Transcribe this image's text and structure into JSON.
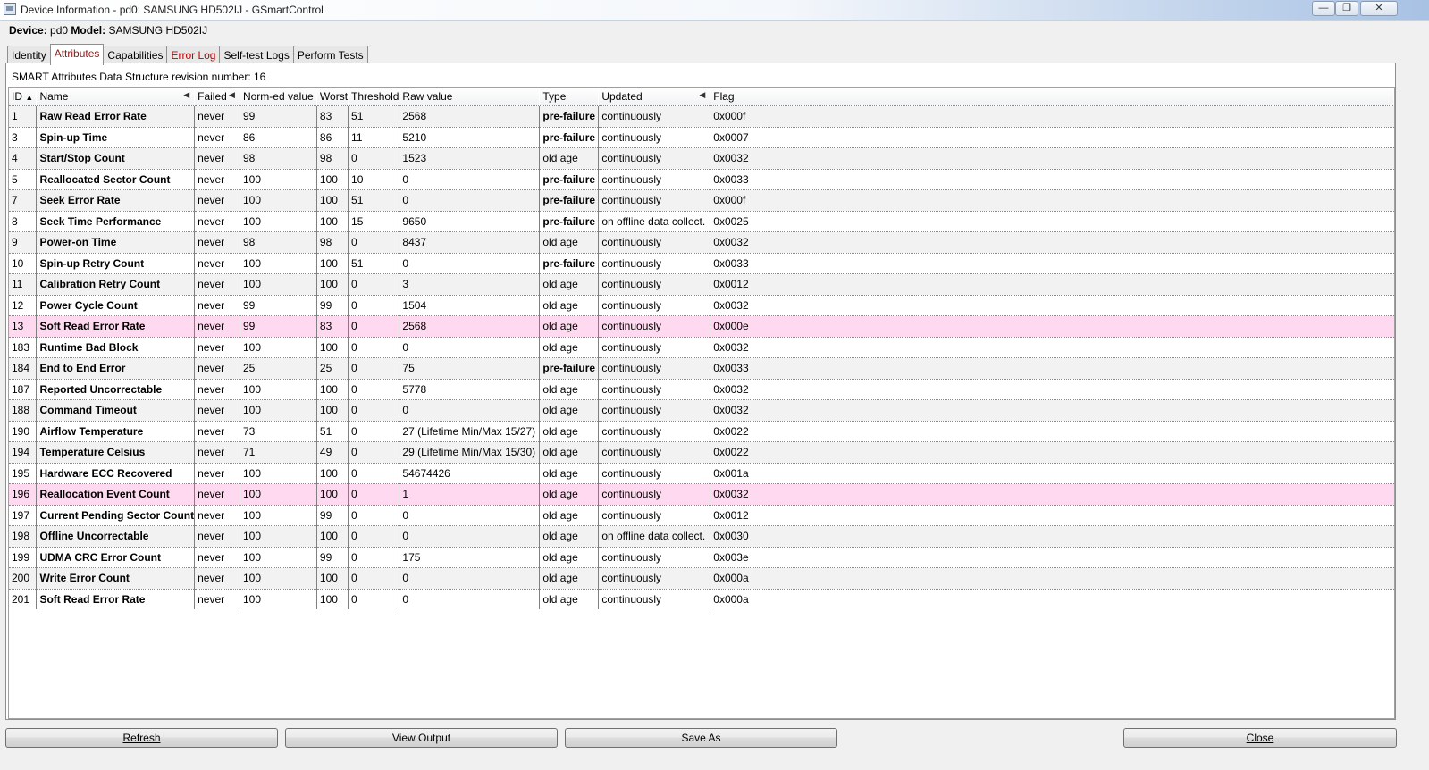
{
  "window": {
    "title": "Device Information - pd0: SAMSUNG HD502IJ - GSmartControl",
    "minimize_glyph": "—",
    "maximize_glyph": "❐",
    "close_glyph": "✕"
  },
  "device": {
    "device_label": "Device:",
    "device_value": "pd0",
    "model_label": "Model:",
    "model_value": "SAMSUNG HD502IJ"
  },
  "tabs": [
    {
      "label": "Identity",
      "active": false
    },
    {
      "label": "Attributes",
      "active": true
    },
    {
      "label": "Capabilities",
      "active": false
    },
    {
      "label": "Error Log",
      "active": false
    },
    {
      "label": "Self-test Logs",
      "active": false
    },
    {
      "label": "Perform Tests",
      "active": false
    }
  ],
  "revision_text": "SMART Attributes Data Structure revision number: 16",
  "columns": [
    "ID",
    "Name",
    "Failed",
    "Norm-ed value",
    "Worst",
    "Threshold",
    "Raw value",
    "Type",
    "Updated",
    "Flag"
  ],
  "rows": [
    [
      "1",
      "Raw Read Error Rate",
      "never",
      "99",
      "83",
      "51",
      "2568",
      "pre-failure",
      "continuously",
      "0x000f"
    ],
    [
      "3",
      "Spin-up Time",
      "never",
      "86",
      "86",
      "11",
      "5210",
      "pre-failure",
      "continuously",
      "0x0007"
    ],
    [
      "4",
      "Start/Stop Count",
      "never",
      "98",
      "98",
      "0",
      "1523",
      "old age",
      "continuously",
      "0x0032"
    ],
    [
      "5",
      "Reallocated Sector Count",
      "never",
      "100",
      "100",
      "10",
      "0",
      "pre-failure",
      "continuously",
      "0x0033"
    ],
    [
      "7",
      "Seek Error Rate",
      "never",
      "100",
      "100",
      "51",
      "0",
      "pre-failure",
      "continuously",
      "0x000f"
    ],
    [
      "8",
      "Seek Time Performance",
      "never",
      "100",
      "100",
      "15",
      "9650",
      "pre-failure",
      "on offline data collect.",
      "0x0025"
    ],
    [
      "9",
      "Power-on Time",
      "never",
      "98",
      "98",
      "0",
      "8437",
      "old age",
      "continuously",
      "0x0032"
    ],
    [
      "10",
      "Spin-up Retry Count",
      "never",
      "100",
      "100",
      "51",
      "0",
      "pre-failure",
      "continuously",
      "0x0033"
    ],
    [
      "11",
      "Calibration Retry Count",
      "never",
      "100",
      "100",
      "0",
      "3",
      "old age",
      "continuously",
      "0x0012"
    ],
    [
      "12",
      "Power Cycle Count",
      "never",
      "99",
      "99",
      "0",
      "1504",
      "old age",
      "continuously",
      "0x0032"
    ],
    [
      "13",
      "Soft Read Error Rate",
      "never",
      "99",
      "83",
      "0",
      "2568",
      "old age",
      "continuously",
      "0x000e"
    ],
    [
      "183",
      "Runtime Bad Block",
      "never",
      "100",
      "100",
      "0",
      "0",
      "old age",
      "continuously",
      "0x0032"
    ],
    [
      "184",
      "End to End Error",
      "never",
      "25",
      "25",
      "0",
      "75",
      "pre-failure",
      "continuously",
      "0x0033"
    ],
    [
      "187",
      "Reported Uncorrectable",
      "never",
      "100",
      "100",
      "0",
      "5778",
      "old age",
      "continuously",
      "0x0032"
    ],
    [
      "188",
      "Command Timeout",
      "never",
      "100",
      "100",
      "0",
      "0",
      "old age",
      "continuously",
      "0x0032"
    ],
    [
      "190",
      "Airflow Temperature",
      "never",
      "73",
      "51",
      "0",
      "27 (Lifetime Min/Max 15/27)",
      "old age",
      "continuously",
      "0x0022"
    ],
    [
      "194",
      "Temperature Celsius",
      "never",
      "71",
      "49",
      "0",
      "29 (Lifetime Min/Max 15/30)",
      "old age",
      "continuously",
      "0x0022"
    ],
    [
      "195",
      "Hardware ECC Recovered",
      "never",
      "100",
      "100",
      "0",
      "54674426",
      "old age",
      "continuously",
      "0x001a"
    ],
    [
      "196",
      "Reallocation Event Count",
      "never",
      "100",
      "100",
      "0",
      "1",
      "old age",
      "continuously",
      "0x0032"
    ],
    [
      "197",
      "Current Pending Sector Count",
      "never",
      "100",
      "99",
      "0",
      "0",
      "old age",
      "continuously",
      "0x0012"
    ],
    [
      "198",
      "Offline Uncorrectable",
      "never",
      "100",
      "100",
      "0",
      "0",
      "old age",
      "on offline data collect.",
      "0x0030"
    ],
    [
      "199",
      "UDMA CRC Error Count",
      "never",
      "100",
      "99",
      "0",
      "175",
      "old age",
      "continuously",
      "0x003e"
    ],
    [
      "200",
      "Write Error Count",
      "never",
      "100",
      "100",
      "0",
      "0",
      "old age",
      "continuously",
      "0x000a"
    ],
    [
      "201",
      "Soft Read Error Rate",
      "never",
      "100",
      "100",
      "0",
      "0",
      "old age",
      "continuously",
      "0x000a"
    ]
  ],
  "highlighted_ids": [
    "13",
    "196"
  ],
  "colors": {
    "highlight_row": "#ffd9ef",
    "alt_row": "#f2f2f2",
    "active_tab_text": "#8b1a1a",
    "error_tab_text": "#c00000"
  },
  "buttons": {
    "refresh": "Refresh",
    "view_output": "View Output",
    "save_as": "Save As",
    "close": "Close"
  }
}
